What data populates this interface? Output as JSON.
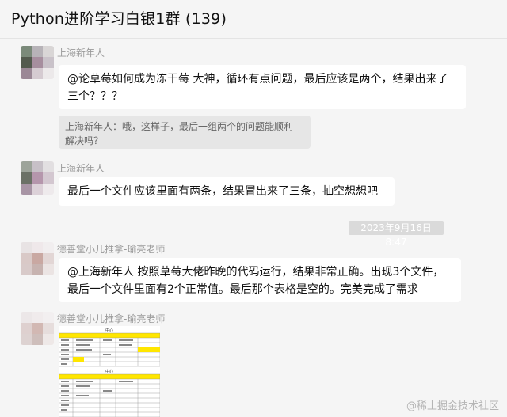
{
  "header": {
    "title": "Python进阶学习白银1群 (139)"
  },
  "messages": [
    {
      "sender": "上海新年人",
      "lines": [
        "@论草莓如何成为冻干莓 大神，循环有点问题，最后应该是两个，结果出来了",
        "三个？？？"
      ]
    },
    {
      "quote_lines": [
        "上海新年人：哦，这样子，最后一组两个的问题能顺利",
        "解决吗？"
      ]
    },
    {
      "sender": "上海新年人",
      "lines": [
        "最后一个文件应该里面有两条，结果冒出来了三条，抽空想想吧"
      ]
    },
    {
      "timestamp": "2023年9月16日 8:47"
    },
    {
      "sender": "德善堂小儿推拿-瑜亮老师",
      "lines": [
        "@上海新年人 按照草莓大佬昨晚的代码运行，结果非常正确。出现3个文件，",
        "最后一个文件里面有2个正常值。最后那个表格是空的。完美完成了需求"
      ]
    },
    {
      "sender": "德善堂小儿推拿-瑜亮老师",
      "image_caption": "中心"
    }
  ],
  "watermark": "@稀土掘金技术社区",
  "colors": {
    "background": "#f5f5f5",
    "bubble": "#ffffff",
    "quote": "#e6e6e6",
    "sender_text": "#9a9a9a",
    "highlight": "#ffe600"
  }
}
